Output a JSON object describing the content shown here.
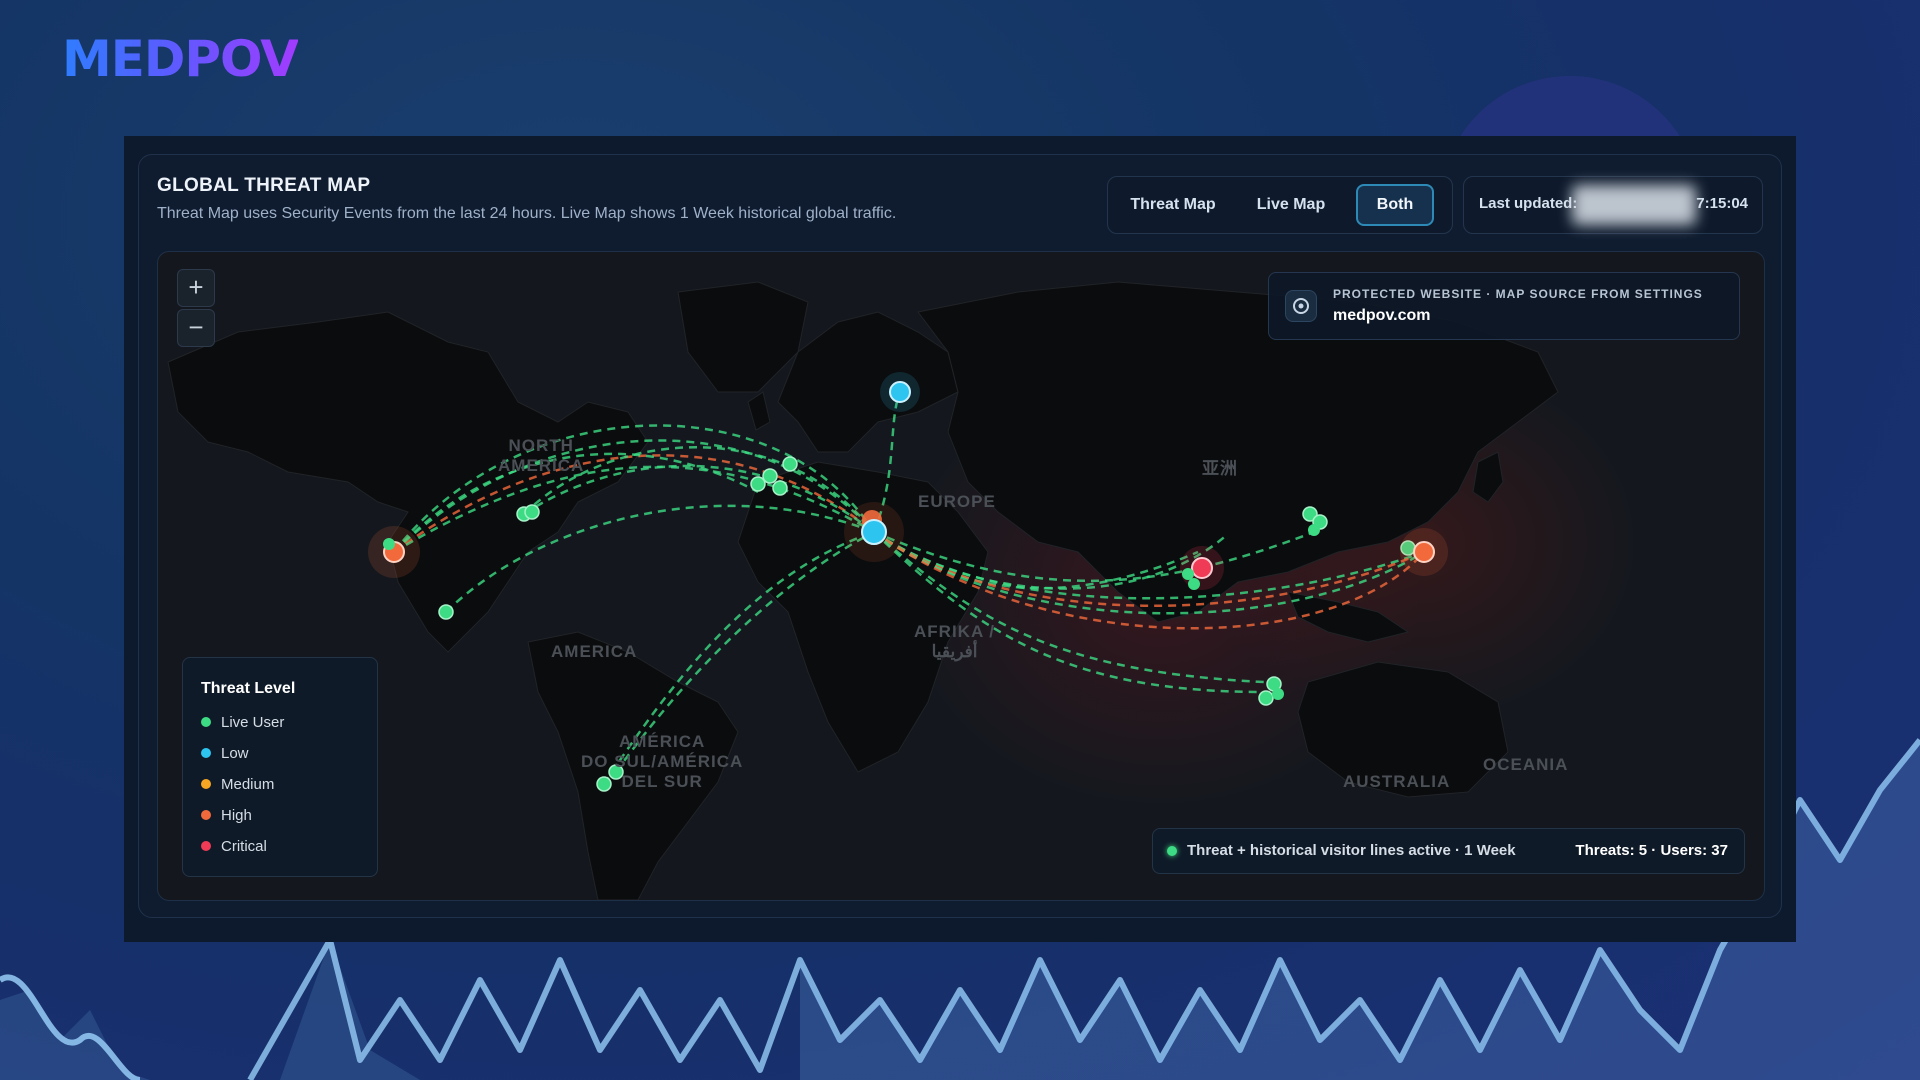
{
  "brand": {
    "logo_text": "MEDPOV"
  },
  "panel": {
    "title": "GLOBAL THREAT MAP",
    "subtitle": "Threat Map uses Security Events from the last 24 hours. Live Map shows 1 Week historical global traffic."
  },
  "view_toggle": {
    "options": [
      "Threat Map",
      "Live Map",
      "Both"
    ],
    "selected": "Both"
  },
  "last_updated": {
    "label": "Last updated:",
    "time": "7:15:04"
  },
  "zoom": {
    "in_label": "+",
    "out_label": "−"
  },
  "map_labels": {
    "north_america_1": "NORTH",
    "north_america_2": "AMERICA",
    "europe": "EUROPE",
    "asia": "亚洲",
    "africa_1": "AFRIKA /",
    "africa_2": "أفريقيا",
    "south_america_1": "AMÉRICA",
    "south_america_2": "DO SUL/AMÉRICA",
    "south_america_3": "DEL SUR",
    "central_america": "AMERICA",
    "australia": "AUSTRALIA",
    "oceania": "OCEANIA"
  },
  "protected": {
    "label": "PROTECTED WEBSITE · MAP SOURCE FROM SETTINGS",
    "domain": "medpov.com",
    "icon": "target-icon"
  },
  "legend": {
    "title": "Threat Level",
    "items": [
      {
        "label": "Live User",
        "color": "#3ddc84"
      },
      {
        "label": "Low",
        "color": "#2ec4f0"
      },
      {
        "label": "Medium",
        "color": "#f5a623"
      },
      {
        "label": "High",
        "color": "#f26a3c"
      },
      {
        "label": "Critical",
        "color": "#ef3b55"
      }
    ]
  },
  "status": {
    "text": "Threat + historical visitor lines active · 1 Week",
    "counts": "Threats: 5 · Users: 37"
  },
  "colors": {
    "live_user": "#3ddc84",
    "low": "#2ec4f0",
    "medium": "#f5a623",
    "high": "#f26a3c",
    "critical": "#ef3b55",
    "accent": "#2d8ab7"
  }
}
